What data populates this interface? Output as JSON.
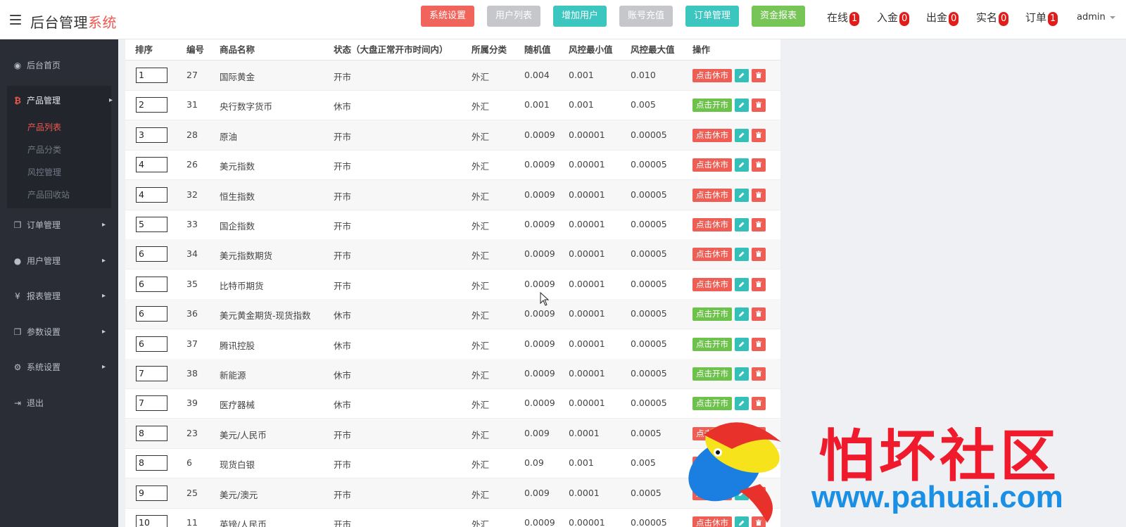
{
  "brand": {
    "title_main": "后台管理",
    "title_highlight": "系统"
  },
  "top_buttons": [
    {
      "label": "系统设置",
      "color": "#f0645c"
    },
    {
      "label": "用户列表",
      "color": "#c5c7ca"
    },
    {
      "label": "增加用户",
      "color": "#3cc6c0"
    },
    {
      "label": "账号充值",
      "color": "#c5c7ca"
    },
    {
      "label": "订单管理",
      "color": "#3cc6c0"
    },
    {
      "label": "资金报表",
      "color": "#76c556"
    }
  ],
  "stats": [
    {
      "label": "在线",
      "count": "1"
    },
    {
      "label": "入金",
      "count": "0"
    },
    {
      "label": "出金",
      "count": "0"
    },
    {
      "label": "实名",
      "count": "0"
    },
    {
      "label": "订单",
      "count": "1"
    }
  ],
  "user": {
    "name": "admin"
  },
  "sidebar": {
    "home": "后台首页",
    "product_mgmt": "产品管理",
    "product_subs": [
      "产品列表",
      "产品分类",
      "风控管理",
      "产品回收站"
    ],
    "order_mgmt": "订单管理",
    "user_mgmt": "用户管理",
    "report_mgmt": "报表管理",
    "param_settings": "参数设置",
    "system_settings": "系统设置",
    "logout": "退出"
  },
  "table": {
    "headers": [
      "排序",
      "编号",
      "商品名称",
      "状态（大盘正常开市时间内）",
      "所属分类",
      "随机值",
      "风控最小值",
      "风控最大值",
      "操作"
    ],
    "rest_label": "点击休市",
    "open_label": "点击开市",
    "rows": [
      {
        "sort": "1",
        "id": "27",
        "name": "国际黄金",
        "status": "开市",
        "category": "外汇",
        "random": "0.004",
        "min": "0.001",
        "max": "0.010",
        "action": "rest"
      },
      {
        "sort": "2",
        "id": "31",
        "name": "央行数字货币",
        "status": "休市",
        "category": "外汇",
        "random": "0.001",
        "min": "0.001",
        "max": "0.005",
        "action": "open"
      },
      {
        "sort": "3",
        "id": "28",
        "name": "原油",
        "status": "开市",
        "category": "外汇",
        "random": "0.0009",
        "min": "0.00001",
        "max": "0.00005",
        "action": "rest"
      },
      {
        "sort": "4",
        "id": "26",
        "name": "美元指数",
        "status": "开市",
        "category": "外汇",
        "random": "0.0009",
        "min": "0.00001",
        "max": "0.00005",
        "action": "rest"
      },
      {
        "sort": "4",
        "id": "32",
        "name": "恒生指数",
        "status": "开市",
        "category": "外汇",
        "random": "0.0009",
        "min": "0.00001",
        "max": "0.00005",
        "action": "rest"
      },
      {
        "sort": "5",
        "id": "33",
        "name": "国企指数",
        "status": "开市",
        "category": "外汇",
        "random": "0.0009",
        "min": "0.00001",
        "max": "0.00005",
        "action": "rest"
      },
      {
        "sort": "6",
        "id": "34",
        "name": "美元指数期货",
        "status": "开市",
        "category": "外汇",
        "random": "0.0009",
        "min": "0.00001",
        "max": "0.00005",
        "action": "rest"
      },
      {
        "sort": "6",
        "id": "35",
        "name": "比特币期货",
        "status": "开市",
        "category": "外汇",
        "random": "0.0009",
        "min": "0.00001",
        "max": "0.00005",
        "action": "rest"
      },
      {
        "sort": "6",
        "id": "36",
        "name": "美元黄金期货-现货指数",
        "status": "休市",
        "category": "外汇",
        "random": "0.0009",
        "min": "0.00001",
        "max": "0.00005",
        "action": "open"
      },
      {
        "sort": "6",
        "id": "37",
        "name": "腾讯控股",
        "status": "休市",
        "category": "外汇",
        "random": "0.0009",
        "min": "0.00001",
        "max": "0.00005",
        "action": "open"
      },
      {
        "sort": "7",
        "id": "38",
        "name": "新能源",
        "status": "休市",
        "category": "外汇",
        "random": "0.0009",
        "min": "0.00001",
        "max": "0.00005",
        "action": "open"
      },
      {
        "sort": "7",
        "id": "39",
        "name": "医疗器械",
        "status": "休市",
        "category": "外汇",
        "random": "0.0009",
        "min": "0.00001",
        "max": "0.00005",
        "action": "open"
      },
      {
        "sort": "8",
        "id": "23",
        "name": "美元/人民币",
        "status": "开市",
        "category": "外汇",
        "random": "0.009",
        "min": "0.0001",
        "max": "0.0005",
        "action": "rest"
      },
      {
        "sort": "8",
        "id": "6",
        "name": "现货白银",
        "status": "开市",
        "category": "外汇",
        "random": "0.09",
        "min": "0.001",
        "max": "0.005",
        "action": "rest"
      },
      {
        "sort": "9",
        "id": "25",
        "name": "美元/澳元",
        "status": "开市",
        "category": "外汇",
        "random": "0.009",
        "min": "0.0001",
        "max": "0.0005",
        "action": "rest"
      },
      {
        "sort": "10",
        "id": "11",
        "name": "英镑/人民币",
        "status": "开市",
        "category": "外汇",
        "random": "0.0009",
        "min": "0.00001",
        "max": "0.00005",
        "action": "rest"
      }
    ]
  },
  "watermark": {
    "text": "怕坏社区",
    "url": "www.pahuai.com"
  }
}
